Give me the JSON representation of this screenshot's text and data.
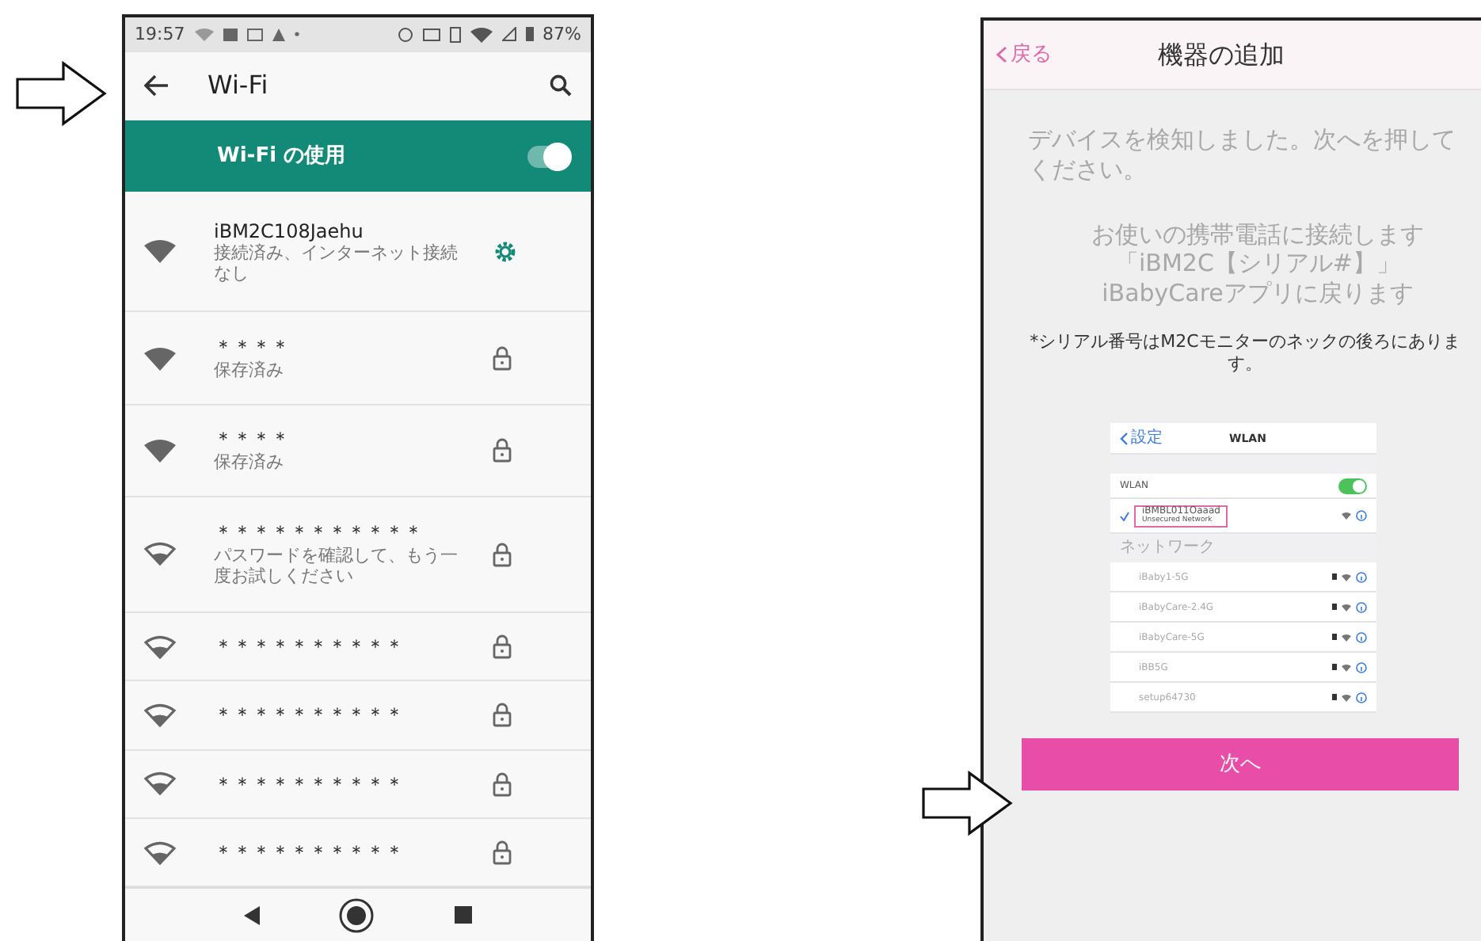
{
  "left_phone": {
    "status_bar": {
      "time": "19:57",
      "battery": "87%"
    },
    "app_bar": {
      "title": "Wi-Fi"
    },
    "wifi_toggle": {
      "label": "Wi-Fi の使用",
      "on": true
    },
    "networks": [
      {
        "name": "iBM2C108Jaehu",
        "status": "接続済み、インターネット接続なし",
        "kind": "connected"
      },
      {
        "name": "＊＊＊＊",
        "status": "保存済み",
        "kind": "saved"
      },
      {
        "name": "＊＊＊＊",
        "status": "保存済み",
        "kind": "saved"
      },
      {
        "name": "＊＊＊＊＊＊＊＊＊＊＊",
        "status": "パスワードを確認して、もう一度お試しください",
        "kind": "weak"
      },
      {
        "name": "＊＊＊＊＊＊＊＊＊＊",
        "kind": "weak"
      },
      {
        "name": "＊＊＊＊＊＊＊＊＊＊",
        "kind": "weak"
      },
      {
        "name": "＊＊＊＊＊＊＊＊＊＊",
        "kind": "weak"
      },
      {
        "name": "＊＊＊＊＊＊＊＊＊＊",
        "kind": "weak"
      }
    ]
  },
  "right_phone": {
    "back": "戻る",
    "title": "機器の追加",
    "message": "デバイスを検知しました。次へを押してください。",
    "instructions": [
      "お使いの携帯電話に接続します",
      "「iBM2C【シリアル#】」",
      "iBabyCareアプリに戻ります"
    ],
    "note": "*シリアル番号はM2Cモニターのネックの後ろにあります。",
    "inset": {
      "back": "設定",
      "title": "WLAN",
      "toggle": {
        "label": "WLAN",
        "on": true
      },
      "current": {
        "name": "iBMBL011Oaaad",
        "status": "Unsecured Network",
        "selected": true
      },
      "section": "ネットワーク",
      "networks": [
        "iBaby1-5G",
        "iBabyCare-2.4G",
        "iBabyCare-5G",
        "iBB5G",
        "setup64730"
      ]
    },
    "button": "次へ"
  }
}
